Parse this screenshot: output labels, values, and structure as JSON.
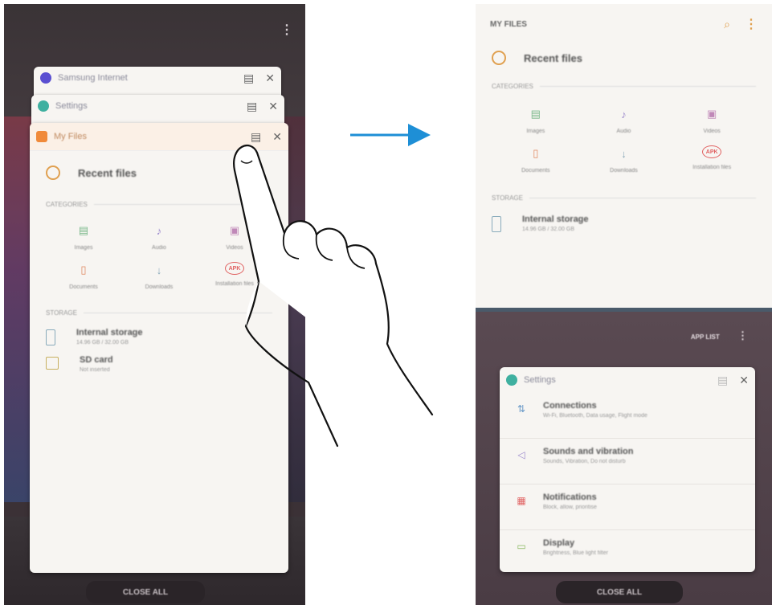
{
  "left_screen": {
    "stack_cards": [
      {
        "title": "Samsung Internet",
        "color": "#5a4fd1"
      },
      {
        "title": "Settings",
        "color": "#3fb0a0"
      }
    ],
    "my_files": {
      "title": "My Files",
      "recent": "Recent files",
      "categories_label": "CATEGORIES",
      "categories": [
        {
          "label": "Images",
          "icon": "▤",
          "color": "#7ab88a"
        },
        {
          "label": "Audio",
          "icon": "♪",
          "color": "#9a88cc"
        },
        {
          "label": "Videos",
          "icon": "▣",
          "color": "#c088b8"
        },
        {
          "label": "Documents",
          "icon": "▯",
          "color": "#e08860"
        },
        {
          "label": "Downloads",
          "icon": "↓",
          "color": "#88a8b8"
        },
        {
          "label": "Installation files",
          "icon": "APK",
          "color": "#e06060"
        }
      ],
      "storage_label": "STORAGE",
      "storage": [
        {
          "title": "Internal storage",
          "sub": "14.96 GB / 32.00 GB"
        },
        {
          "title": "SD card",
          "sub": "Not inserted"
        }
      ]
    },
    "close_all": "CLOSE ALL"
  },
  "right_screen": {
    "my_files": {
      "title": "MY FILES",
      "recent": "Recent files",
      "categories_label": "CATEGORIES",
      "categories": [
        {
          "label": "Images",
          "icon": "▤",
          "color": "#7ab88a"
        },
        {
          "label": "Audio",
          "icon": "♪",
          "color": "#9a88cc"
        },
        {
          "label": "Videos",
          "icon": "▣",
          "color": "#c088b8"
        },
        {
          "label": "Documents",
          "icon": "▯",
          "color": "#e08860"
        },
        {
          "label": "Downloads",
          "icon": "↓",
          "color": "#88a8b8"
        },
        {
          "label": "Installation files",
          "icon": "APK",
          "color": "#e06060"
        }
      ],
      "storage_label": "STORAGE",
      "storage": [
        {
          "title": "Internal storage",
          "sub": "14.96 GB / 32.00 GB"
        }
      ]
    },
    "app_list": "APP LIST",
    "settings_card": {
      "title": "Settings",
      "items": [
        {
          "title": "Connections",
          "sub": "Wi-Fi, Bluetooth, Data usage, Flight mode",
          "icon": "⇅",
          "color": "#6a9ac8"
        },
        {
          "title": "Sounds and vibration",
          "sub": "Sounds, Vibration, Do not disturb",
          "icon": "◁",
          "color": "#9a88cc"
        },
        {
          "title": "Notifications",
          "sub": "Block, allow, prioritise",
          "icon": "▦",
          "color": "#e06060"
        },
        {
          "title": "Display",
          "sub": "Brightness, Blue light filter",
          "icon": "▭",
          "color": "#8ab860"
        }
      ]
    },
    "close_all": "CLOSE ALL"
  },
  "colors": {
    "arrow": "#1e8fd6",
    "accent_orange": "#e0a050"
  }
}
